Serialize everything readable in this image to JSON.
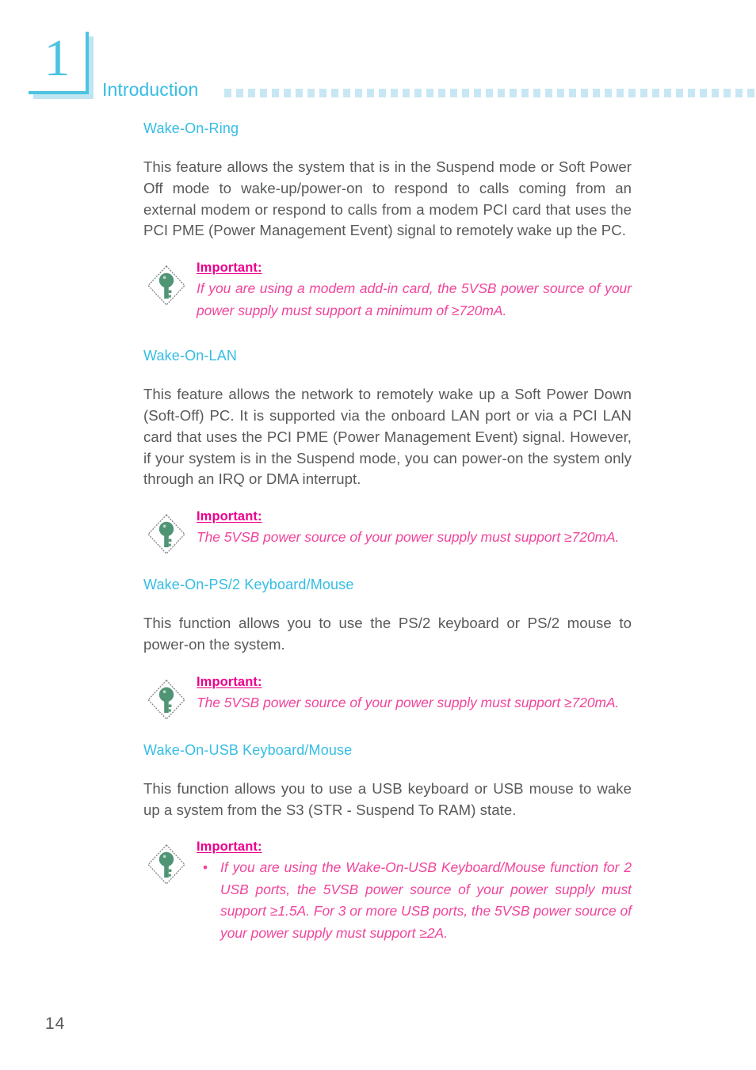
{
  "header": {
    "chapter_number": "1",
    "chapter_title": "Introduction",
    "dot_count": 45,
    "accent_color": "#35bde4",
    "dot_color": "#c8e7f4",
    "shadow_color": "#bfe4f2"
  },
  "page_number": "14",
  "colors": {
    "heading": "#35bde4",
    "body_text": "#58595b",
    "note_title": "#ec008c",
    "note_text": "#f0459b",
    "icon_key": "#4f9475",
    "icon_diamond": "#808285"
  },
  "icons": {
    "note": "key-diamond-icon"
  },
  "sections": [
    {
      "heading": "Wake-On-Ring",
      "paragraph": "This feature allows the system that is in the Suspend mode or Soft Power Off mode to wake-up/power-on to respond to calls coming from an external modem or respond to calls from a modem PCI card that uses the PCI PME (Power Management Event) signal to remotely wake up the PC.",
      "note": {
        "title": "Important:",
        "text": "If you are using a modem add-in card, the 5VSB power source of your power supply must support a minimum of ≥720mA."
      }
    },
    {
      "heading": "Wake-On-LAN",
      "paragraph": "This feature allows the network to remotely wake up a Soft Power Down (Soft-Off) PC. It is supported via the onboard LAN port or via a PCI LAN card that uses the PCI PME (Power Management Event) signal. However, if your system is in the Suspend mode, you can power-on the system only through an IRQ or DMA interrupt.",
      "note": {
        "title": "Important:",
        "text": "The 5VSB power source of your power supply must support ≥720mA."
      }
    },
    {
      "heading": "Wake-On-PS/2 Keyboard/Mouse",
      "paragraph": "This function allows you to use the PS/2 keyboard or PS/2 mouse to power-on the system.",
      "note": {
        "title": "Important:",
        "text": "The 5VSB power source of your power supply must support ≥720mA."
      }
    },
    {
      "heading": "Wake-On-USB Keyboard/Mouse",
      "paragraph": "This function allows you to use a USB keyboard or USB mouse to wake up a system from the S3 (STR - Suspend To RAM) state.",
      "note": {
        "title": "Important:",
        "bullet": "•",
        "items": [
          "If you are using the Wake-On-USB Keyboard/Mouse function for 2 USB ports, the 5VSB power source of your power supply must support ≥1.5A. For 3 or more USB ports, the 5VSB power source of your power supply must support ≥2A."
        ]
      }
    }
  ]
}
